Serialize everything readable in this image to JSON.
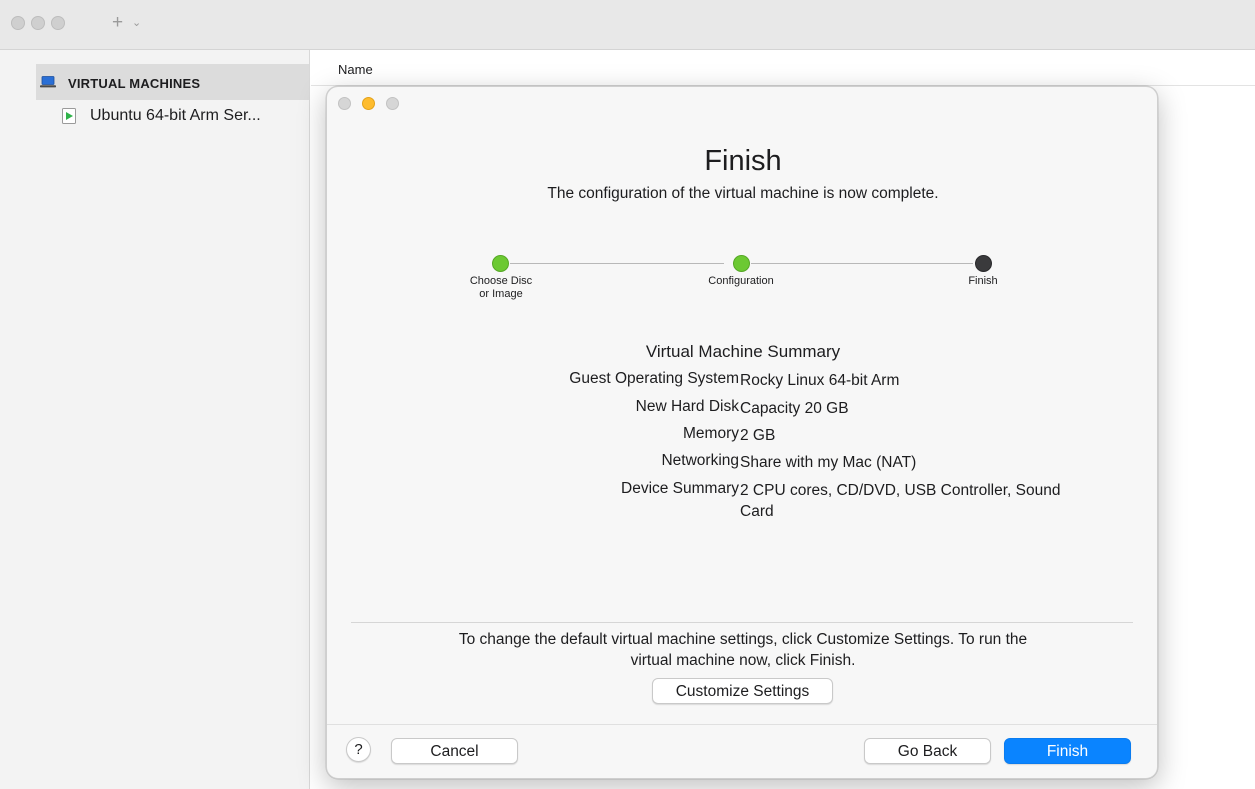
{
  "toolbar": {
    "add_glyph": "+",
    "add_chevron": "⌄"
  },
  "sidebar": {
    "header_label": "VIRTUAL MACHINES",
    "items": [
      {
        "label": "Ubuntu 64-bit Arm Ser..."
      }
    ]
  },
  "main": {
    "column_header": "Name"
  },
  "dialog": {
    "title": "Finish",
    "subtitle": "The configuration of the virtual machine is now complete.",
    "steps": [
      {
        "label_line1": "Choose Disc",
        "label_line2": "or Image",
        "state": "complete",
        "color": "#6cc932"
      },
      {
        "label_line1": "Configuration",
        "label_line2": "",
        "state": "complete",
        "color": "#6cc932"
      },
      {
        "label_line1": "Finish",
        "label_line2": "",
        "state": "current",
        "color": "#3a3a3c"
      }
    ],
    "summary": {
      "title": "Virtual Machine Summary",
      "rows": [
        {
          "key": "Guest Operating System",
          "value": "Rocky Linux 64-bit Arm"
        },
        {
          "key": "New Hard Disk",
          "value": "Capacity 20 GB"
        },
        {
          "key": "Memory",
          "value": "2 GB"
        },
        {
          "key": "Networking",
          "value": "Share with my Mac (NAT)"
        },
        {
          "key": "Device Summary",
          "value": "2 CPU cores, CD/DVD, USB Controller, Sound Card"
        }
      ]
    },
    "hint_line1": "To change the default virtual machine settings, click Customize Settings. To run the",
    "hint_line2": "virtual machine now, click Finish.",
    "customize_label": "Customize Settings",
    "help_label": "?",
    "cancel_label": "Cancel",
    "go_back_label": "Go Back",
    "finish_label": "Finish"
  },
  "colors": {
    "accent": "#0a84ff",
    "step_complete": "#6cc932",
    "step_current": "#3a3a3c",
    "minimize": "#febc2e",
    "vm_running": "#2fb34a"
  }
}
